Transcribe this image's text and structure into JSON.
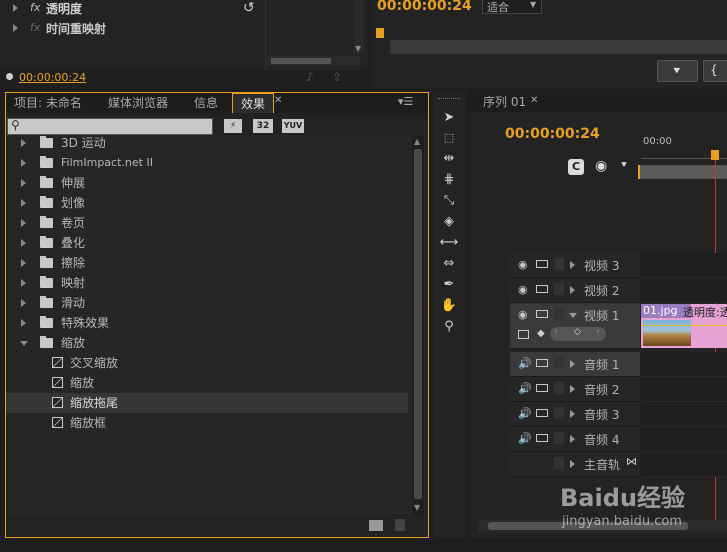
{
  "top_left": {
    "rows": [
      {
        "fx": "fx",
        "label": "透明度"
      },
      {
        "fx": "fx",
        "label": "时间重映射"
      }
    ],
    "timecode": "00:00:00:24"
  },
  "program_monitor": {
    "timecode": "00:00:00:24",
    "zoom_select": "适合"
  },
  "project_panel": {
    "tabs": [
      "项目: 未命名",
      "媒体浏览器",
      "信息",
      "效果"
    ],
    "active_tab": "效果",
    "search_placeholder": "",
    "badges": [
      "32",
      "YUV"
    ],
    "effects": [
      {
        "type": "folder",
        "label": "3D 运动",
        "expanded": false
      },
      {
        "type": "folder",
        "label": "FilmImpact.net II",
        "expanded": false
      },
      {
        "type": "folder",
        "label": "伸展",
        "expanded": false
      },
      {
        "type": "folder",
        "label": "划像",
        "expanded": false
      },
      {
        "type": "folder",
        "label": "卷页",
        "expanded": false
      },
      {
        "type": "folder",
        "label": "叠化",
        "expanded": false
      },
      {
        "type": "folder",
        "label": "擦除",
        "expanded": false
      },
      {
        "type": "folder",
        "label": "映射",
        "expanded": false
      },
      {
        "type": "folder",
        "label": "滑动",
        "expanded": false
      },
      {
        "type": "folder",
        "label": "特殊效果",
        "expanded": false
      },
      {
        "type": "folder",
        "label": "缩放",
        "expanded": true
      },
      {
        "type": "effect",
        "label": "交叉缩放"
      },
      {
        "type": "effect",
        "label": "缩放"
      },
      {
        "type": "effect",
        "label": "缩放拖尾",
        "selected": true
      },
      {
        "type": "effect",
        "label": "缩放框"
      }
    ]
  },
  "timeline": {
    "tab_label": "序列 01",
    "timecode": "00:00:00:24",
    "ruler_label": "00:00",
    "tracks": [
      {
        "kind": "video",
        "label": "视频 3"
      },
      {
        "kind": "video",
        "label": "视频 2"
      },
      {
        "kind": "video",
        "label": "视频 1",
        "expanded": true
      },
      {
        "kind": "audio",
        "label": "音频 1",
        "selected": true
      },
      {
        "kind": "audio",
        "label": "音频 2"
      },
      {
        "kind": "audio",
        "label": "音频 3"
      },
      {
        "kind": "audio",
        "label": "音频 4"
      },
      {
        "kind": "master",
        "label": "主音轨"
      }
    ],
    "clip_label": "01.jpg",
    "clip_effect_label": "透明度:透"
  },
  "watermark": {
    "brand": "Baidu经验",
    "url": "jingyan.baidu.com"
  },
  "colors": {
    "accent": "#e8a020",
    "clip_pink": "#e7a3d3",
    "clip_header": "#9b7cc0"
  }
}
